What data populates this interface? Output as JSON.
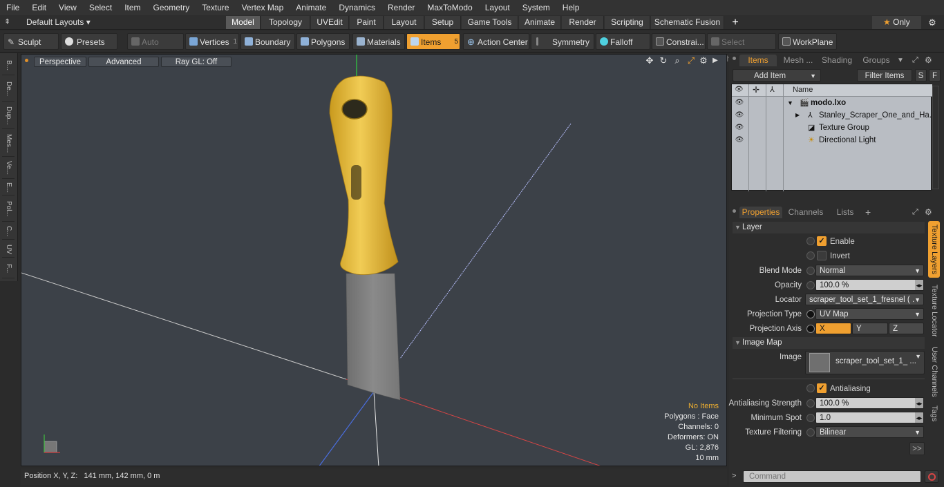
{
  "menu": [
    "File",
    "Edit",
    "View",
    "Select",
    "Item",
    "Geometry",
    "Texture",
    "Vertex Map",
    "Animate",
    "Dynamics",
    "Render",
    "MaxToModo",
    "Layout",
    "System",
    "Help"
  ],
  "layout_selector": "Default Layouts",
  "layout_tabs": [
    "Model",
    "Topology",
    "UVEdit",
    "Paint",
    "Layout",
    "Setup",
    "Game Tools",
    "Animate",
    "Render",
    "Scripting",
    "Schematic Fusion"
  ],
  "layout_tab_active": "Model",
  "only_label": "Only",
  "toolbar": {
    "sculpt": "Sculpt",
    "presets": "Presets",
    "auto_select": "Auto Select",
    "vertices": "Vertices",
    "vertices_count": "1",
    "boundary": "Boundary",
    "polygons": "Polygons",
    "materials": "Materials",
    "items": "Items",
    "items_count": "5",
    "action_center": "Action Center",
    "symmetry": "Symmetry",
    "falloff": "Falloff",
    "constraints": "Constrai...",
    "select_through": "Select Through",
    "workplane": "WorkPlane"
  },
  "left_tabs": [
    "B...",
    "De...",
    "Dup...",
    "Mes...",
    "Ve...",
    "E...",
    "Pol...",
    "C...",
    "UV",
    "F..."
  ],
  "viewport": {
    "view": "Perspective",
    "shading": "Advanced",
    "raygl": "Ray GL: Off",
    "hud": {
      "selection": "No Items",
      "polygons": "Polygons : Face",
      "channels": "Channels: 0",
      "deformers": "Deformers: ON",
      "gl": "GL: 2,876",
      "grid": "10 mm"
    }
  },
  "status": "Position X, Y, Z:   141 mm, 142 mm, 0 m",
  "items_panel": {
    "tabs": [
      "Items",
      "Mesh ...",
      "Shading",
      "Groups"
    ],
    "add_item": "Add Item",
    "filter_items": "Filter Items",
    "s": "S",
    "f": "F",
    "name_header": "Name",
    "rows": [
      "modo.lxo",
      "Stanley_Scraper_One_and_Ha...",
      "Texture Group",
      "Directional Light"
    ]
  },
  "properties_panel": {
    "tabs": [
      "Properties",
      "Channels",
      "Lists"
    ],
    "layer_section": "Layer",
    "enable": "Enable",
    "invert": "Invert",
    "blend_mode_label": "Blend Mode",
    "blend_mode": "Normal",
    "opacity_label": "Opacity",
    "opacity": "100.0 %",
    "locator_label": "Locator",
    "locator": "scraper_tool_set_1_fresnel ( ...",
    "projection_type_label": "Projection Type",
    "projection_type": "UV Map",
    "projection_axis_label": "Projection Axis",
    "axis_x": "X",
    "axis_y": "Y",
    "axis_z": "Z",
    "image_map_section": "Image Map",
    "image_label": "Image",
    "image": "scraper_tool_set_1_ ...",
    "antialiasing": "Antialiasing",
    "aa_strength_label": "Antialiasing Strength",
    "aa_strength": "100.0 %",
    "min_spot_label": "Minimum Spot",
    "min_spot": "1.0",
    "tex_filter_label": "Texture Filtering",
    "tex_filter": "Bilinear",
    "more": ">>",
    "side_tabs": [
      "Texture Layers",
      "Texture Locator",
      "User Channels",
      "Tags"
    ]
  },
  "command_placeholder": "Command"
}
